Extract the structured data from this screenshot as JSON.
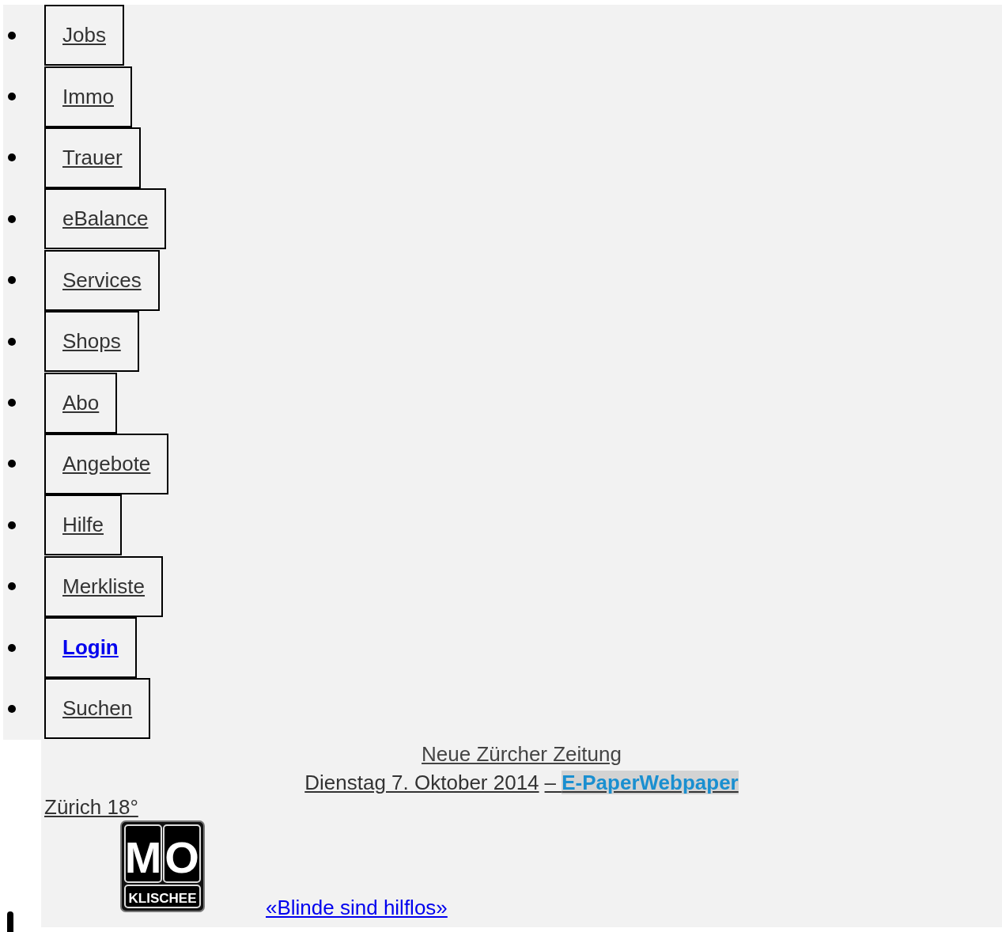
{
  "nav": [
    {
      "label": "Jobs",
      "kind": "link"
    },
    {
      "label": "Immo",
      "kind": "link"
    },
    {
      "label": "Trauer",
      "kind": "link"
    },
    {
      "label": "eBalance",
      "kind": "link"
    },
    {
      "label": "Services",
      "kind": "link"
    },
    {
      "label": "Shops",
      "kind": "link"
    },
    {
      "label": "Abo",
      "kind": "link"
    },
    {
      "label": "Angebote",
      "kind": "link"
    },
    {
      "label": "Hilfe",
      "kind": "link"
    },
    {
      "label": "Merkliste",
      "kind": "link"
    },
    {
      "label": "Login",
      "kind": "login"
    },
    {
      "label": "Suchen",
      "kind": "link"
    }
  ],
  "masthead": {
    "title": "Neue Zürcher Zeitung",
    "date": "Dienstag 7. Oktober 2014",
    "dash": "– ",
    "epaper": "E-PaperWebpaper"
  },
  "weather": "Zürich 18°",
  "logo": {
    "left": "M",
    "right": "O",
    "caption": "KLISCHEE"
  },
  "teaser_link": "«Blinde sind hilflos»"
}
